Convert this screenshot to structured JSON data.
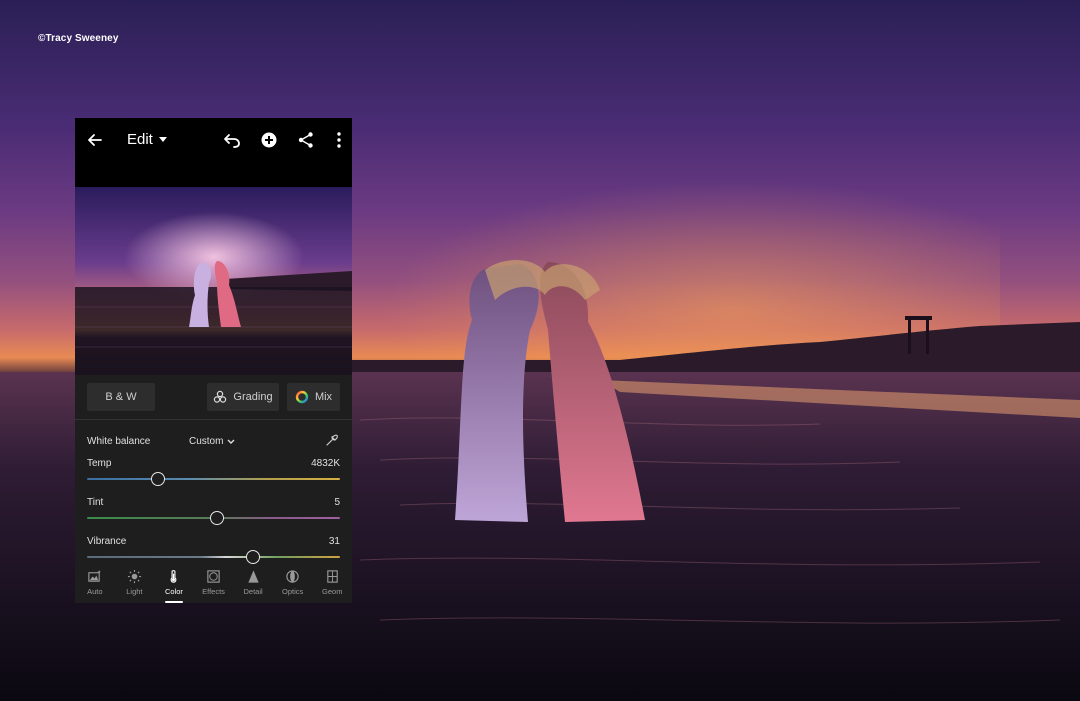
{
  "credit": "©Tracy Sweeney",
  "app": {
    "title": "Edit",
    "icons": {
      "back": "arrow-left-icon",
      "undo": "undo-icon",
      "add": "plus-circle-icon",
      "share": "share-icon",
      "more": "more-vertical-icon"
    }
  },
  "segments": {
    "bw": "B & W",
    "grading": "Grading",
    "mix": "Mix"
  },
  "white_balance": {
    "label": "White balance",
    "preset": "Custom"
  },
  "sliders": [
    {
      "label": "Temp",
      "value": "4832K",
      "position": 0.28
    },
    {
      "label": "Tint",
      "value": "5",
      "position": 0.515
    },
    {
      "label": "Vibrance",
      "value": "31",
      "position": 0.655
    }
  ],
  "tabs": [
    {
      "label": "Auto",
      "icon": "auto-photo-icon"
    },
    {
      "label": "Light",
      "icon": "sun-icon"
    },
    {
      "label": "Color",
      "icon": "thermometer-icon",
      "active": true
    },
    {
      "label": "Effects",
      "icon": "effects-icon"
    },
    {
      "label": "Detail",
      "icon": "detail-icon"
    },
    {
      "label": "Optics",
      "icon": "optics-icon"
    },
    {
      "label": "Geom",
      "icon": "geometry-icon"
    }
  ],
  "colors": {
    "panel": "#1e1e1e",
    "topbar": "#000000",
    "accent": "#ffffff"
  }
}
